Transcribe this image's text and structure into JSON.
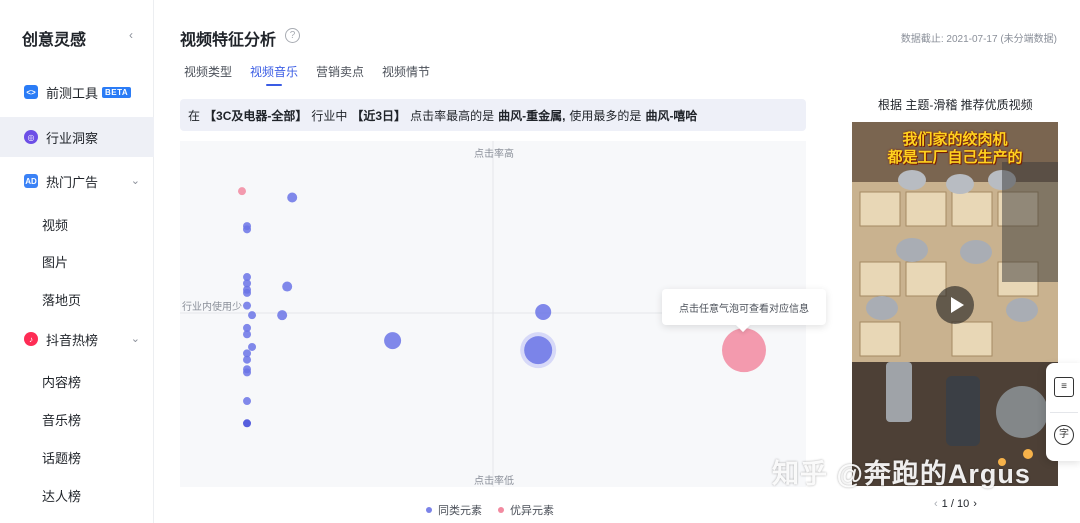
{
  "sidebar": {
    "brand": "创意灵感",
    "collapse_icon": "chevron-left",
    "items": [
      {
        "label": "前测工具",
        "badge": "BETA",
        "icon": "code-icon"
      },
      {
        "label": "行业洞察",
        "icon": "compass-icon",
        "active": true
      },
      {
        "label": "热门广告",
        "icon": "ad-icon"
      },
      {
        "label": "抖音热榜",
        "icon": "tiktok-icon"
      }
    ],
    "hot_ads_sub": [
      "视频",
      "图片",
      "落地页"
    ],
    "douyin_sub": [
      "内容榜",
      "音乐榜",
      "话题榜",
      "达人榜"
    ]
  },
  "header": {
    "title": "视频特征分析",
    "deadline": "数据截止: 2021-07-17 (未分端数据)"
  },
  "tabs": [
    "视频类型",
    "视频音乐",
    "营销卖点",
    "视频情节"
  ],
  "active_tab": "视频音乐",
  "summary": {
    "prefix": "在",
    "category": "【3C及电器-全部】",
    "mid1": "行业中",
    "period": "【近3日】",
    "mid2": "点击率最高的是",
    "top_ctr": "曲风-重金属,",
    "mid3": "使用最多的是",
    "most_used": "曲风-嘻哈"
  },
  "chart": {
    "top_label": "点击率高",
    "bottom_label": "点击率低",
    "left_label": "行业内使用少",
    "tooltip": "点击任意气泡可查看对应信息"
  },
  "legend": [
    {
      "label": "同类元素",
      "color": "#7b83e8"
    },
    {
      "label": "优异元素",
      "color": "#f28aa0"
    }
  ],
  "chart_data": {
    "type": "scatter",
    "series": [
      {
        "name": "同类元素",
        "color": "#6b74e6",
        "points": [
          [
            0.1,
            0.86
          ],
          [
            0.01,
            0.77
          ],
          [
            0.01,
            0.76
          ],
          [
            0.01,
            0.61
          ],
          [
            0.01,
            0.59
          ],
          [
            0.01,
            0.57
          ],
          [
            0.01,
            0.56
          ],
          [
            0.09,
            0.58
          ],
          [
            0.01,
            0.52
          ],
          [
            0.02,
            0.49
          ],
          [
            0.08,
            0.49
          ],
          [
            0.01,
            0.45
          ],
          [
            0.01,
            0.43
          ],
          [
            0.01,
            0.37
          ],
          [
            0.02,
            0.39
          ],
          [
            0.01,
            0.35
          ],
          [
            0.01,
            0.31
          ],
          [
            0.01,
            0.32
          ],
          [
            0.01,
            0.22
          ],
          [
            0.01,
            0.15
          ],
          [
            0.3,
            0.41
          ],
          [
            0.6,
            0.5
          ],
          [
            0.59,
            0.38
          ]
        ]
      },
      {
        "name": "优异元素",
        "color": "#f28aa0",
        "points": [
          [
            0.0,
            0.88
          ],
          [
            1.0,
            0.38
          ]
        ]
      }
    ]
  },
  "recommend": {
    "title": "根据 主题-滑稽 推荐优质视频",
    "video_text_1": "我们家的绞肉机",
    "video_text_2": "都是工厂自己生产的",
    "pager": "1 / 10"
  },
  "watermark": "知乎 @奔跑的Argus",
  "float_buttons": [
    "doc-icon",
    "char-icon"
  ]
}
